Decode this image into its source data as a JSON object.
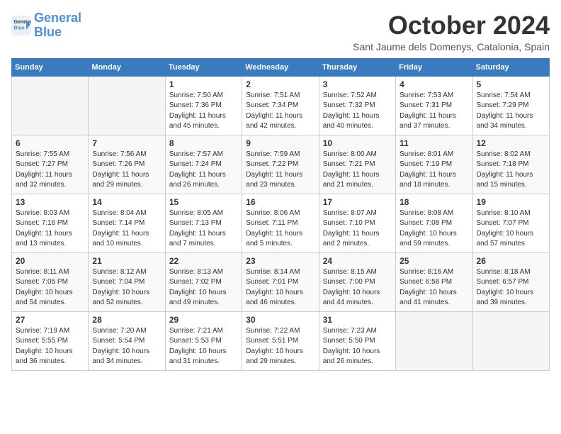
{
  "logo": {
    "line1": "General",
    "line2": "Blue"
  },
  "title": "October 2024",
  "subtitle": "Sant Jaume dels Domenys, Catalonia, Spain",
  "days_of_week": [
    "Sunday",
    "Monday",
    "Tuesday",
    "Wednesday",
    "Thursday",
    "Friday",
    "Saturday"
  ],
  "weeks": [
    [
      {
        "day": null
      },
      {
        "day": null
      },
      {
        "day": 1,
        "sunrise": "7:50 AM",
        "sunset": "7:36 PM",
        "daylight": "11 hours and 45 minutes."
      },
      {
        "day": 2,
        "sunrise": "7:51 AM",
        "sunset": "7:34 PM",
        "daylight": "11 hours and 42 minutes."
      },
      {
        "day": 3,
        "sunrise": "7:52 AM",
        "sunset": "7:32 PM",
        "daylight": "11 hours and 40 minutes."
      },
      {
        "day": 4,
        "sunrise": "7:53 AM",
        "sunset": "7:31 PM",
        "daylight": "11 hours and 37 minutes."
      },
      {
        "day": 5,
        "sunrise": "7:54 AM",
        "sunset": "7:29 PM",
        "daylight": "11 hours and 34 minutes."
      }
    ],
    [
      {
        "day": 6,
        "sunrise": "7:55 AM",
        "sunset": "7:27 PM",
        "daylight": "11 hours and 32 minutes."
      },
      {
        "day": 7,
        "sunrise": "7:56 AM",
        "sunset": "7:26 PM",
        "daylight": "11 hours and 29 minutes."
      },
      {
        "day": 8,
        "sunrise": "7:57 AM",
        "sunset": "7:24 PM",
        "daylight": "11 hours and 26 minutes."
      },
      {
        "day": 9,
        "sunrise": "7:59 AM",
        "sunset": "7:22 PM",
        "daylight": "11 hours and 23 minutes."
      },
      {
        "day": 10,
        "sunrise": "8:00 AM",
        "sunset": "7:21 PM",
        "daylight": "11 hours and 21 minutes."
      },
      {
        "day": 11,
        "sunrise": "8:01 AM",
        "sunset": "7:19 PM",
        "daylight": "11 hours and 18 minutes."
      },
      {
        "day": 12,
        "sunrise": "8:02 AM",
        "sunset": "7:18 PM",
        "daylight": "11 hours and 15 minutes."
      }
    ],
    [
      {
        "day": 13,
        "sunrise": "8:03 AM",
        "sunset": "7:16 PM",
        "daylight": "11 hours and 13 minutes."
      },
      {
        "day": 14,
        "sunrise": "8:04 AM",
        "sunset": "7:14 PM",
        "daylight": "11 hours and 10 minutes."
      },
      {
        "day": 15,
        "sunrise": "8:05 AM",
        "sunset": "7:13 PM",
        "daylight": "11 hours and 7 minutes."
      },
      {
        "day": 16,
        "sunrise": "8:06 AM",
        "sunset": "7:11 PM",
        "daylight": "11 hours and 5 minutes."
      },
      {
        "day": 17,
        "sunrise": "8:07 AM",
        "sunset": "7:10 PM",
        "daylight": "11 hours and 2 minutes."
      },
      {
        "day": 18,
        "sunrise": "8:08 AM",
        "sunset": "7:08 PM",
        "daylight": "10 hours and 59 minutes."
      },
      {
        "day": 19,
        "sunrise": "8:10 AM",
        "sunset": "7:07 PM",
        "daylight": "10 hours and 57 minutes."
      }
    ],
    [
      {
        "day": 20,
        "sunrise": "8:11 AM",
        "sunset": "7:05 PM",
        "daylight": "10 hours and 54 minutes."
      },
      {
        "day": 21,
        "sunrise": "8:12 AM",
        "sunset": "7:04 PM",
        "daylight": "10 hours and 52 minutes."
      },
      {
        "day": 22,
        "sunrise": "8:13 AM",
        "sunset": "7:02 PM",
        "daylight": "10 hours and 49 minutes."
      },
      {
        "day": 23,
        "sunrise": "8:14 AM",
        "sunset": "7:01 PM",
        "daylight": "10 hours and 46 minutes."
      },
      {
        "day": 24,
        "sunrise": "8:15 AM",
        "sunset": "7:00 PM",
        "daylight": "10 hours and 44 minutes."
      },
      {
        "day": 25,
        "sunrise": "8:16 AM",
        "sunset": "6:58 PM",
        "daylight": "10 hours and 41 minutes."
      },
      {
        "day": 26,
        "sunrise": "8:18 AM",
        "sunset": "6:57 PM",
        "daylight": "10 hours and 39 minutes."
      }
    ],
    [
      {
        "day": 27,
        "sunrise": "7:19 AM",
        "sunset": "5:55 PM",
        "daylight": "10 hours and 36 minutes."
      },
      {
        "day": 28,
        "sunrise": "7:20 AM",
        "sunset": "5:54 PM",
        "daylight": "10 hours and 34 minutes."
      },
      {
        "day": 29,
        "sunrise": "7:21 AM",
        "sunset": "5:53 PM",
        "daylight": "10 hours and 31 minutes."
      },
      {
        "day": 30,
        "sunrise": "7:22 AM",
        "sunset": "5:51 PM",
        "daylight": "10 hours and 29 minutes."
      },
      {
        "day": 31,
        "sunrise": "7:23 AM",
        "sunset": "5:50 PM",
        "daylight": "10 hours and 26 minutes."
      },
      {
        "day": null
      },
      {
        "day": null
      }
    ]
  ]
}
